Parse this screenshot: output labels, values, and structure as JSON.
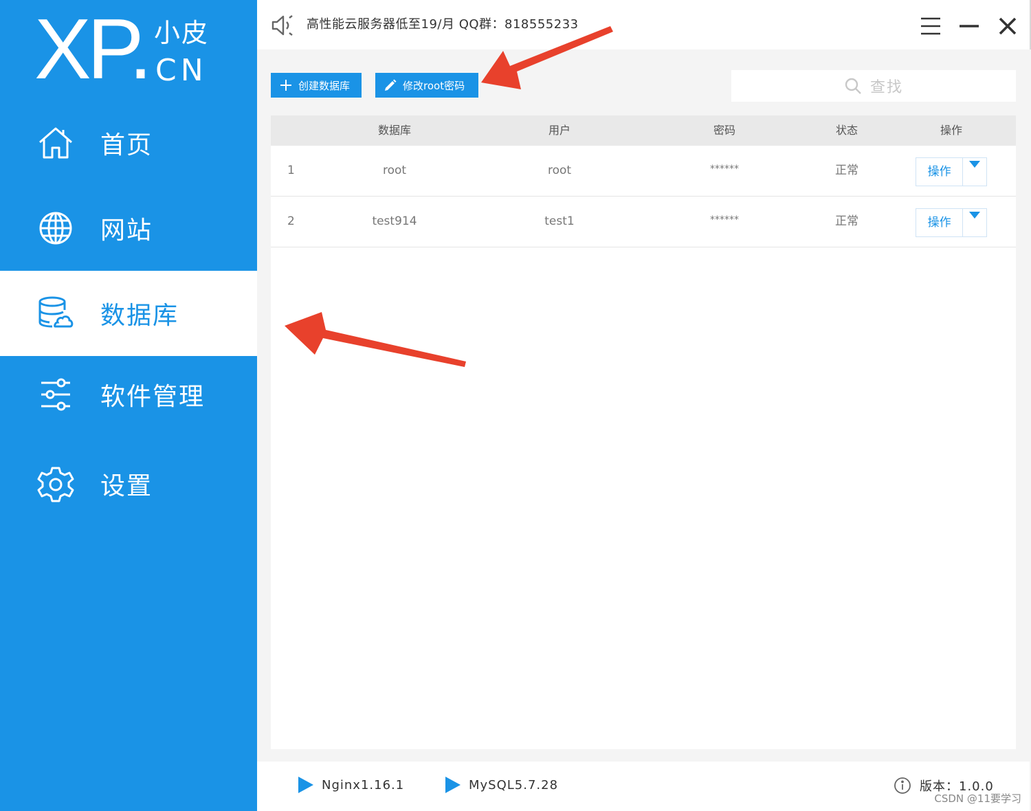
{
  "logo": {
    "main": "XP.",
    "sub_top": "小皮",
    "sub_bottom": "CN"
  },
  "sidebar": {
    "items": [
      {
        "label": "首页",
        "icon": "home-icon"
      },
      {
        "label": "网站",
        "icon": "globe-icon"
      },
      {
        "label": "数据库",
        "icon": "database-icon",
        "active": true
      },
      {
        "label": "软件管理",
        "icon": "sliders-icon"
      },
      {
        "label": "设置",
        "icon": "gear-icon"
      }
    ]
  },
  "topbar": {
    "notice": "高性能云服务器低至19/月  QQ群：818555233"
  },
  "toolbar": {
    "create_label": "创建数据库",
    "change_pwd_label": "修改root密码",
    "search_placeholder": "查找"
  },
  "table": {
    "headers": [
      "数据库",
      "用户",
      "密码",
      "状态",
      "操作"
    ],
    "rows": [
      {
        "index": "1",
        "database": "root",
        "user": "root",
        "password": "******",
        "status": "正常",
        "action": "操作"
      },
      {
        "index": "2",
        "database": "test914",
        "user": "test1",
        "password": "******",
        "status": "正常",
        "action": "操作"
      }
    ]
  },
  "footer": {
    "nginx": "Nginx1.16.1",
    "mysql": "MySQL5.7.28",
    "version": "版本：1.0.0",
    "watermark": "CSDN @11要学习"
  },
  "colors": {
    "brand": "#1a93e6",
    "arrow": "#e8412c"
  }
}
